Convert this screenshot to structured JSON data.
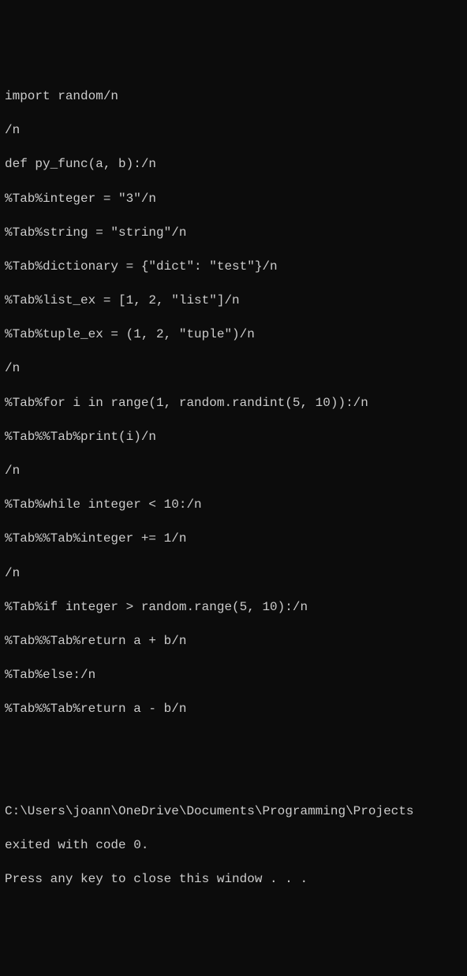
{
  "terminal": {
    "lines": [
      "import random/n",
      "/n",
      "def py_func(a, b):/n",
      "%Tab%integer = \"3\"/n",
      "%Tab%string = \"string\"/n",
      "%Tab%dictionary = {\"dict\": \"test\"}/n",
      "%Tab%list_ex = [1, 2, \"list\"]/n",
      "%Tab%tuple_ex = (1, 2, \"tuple\")/n",
      "/n",
      "%Tab%for i in range(1, random.randint(5, 10)):/n",
      "%Tab%%Tab%print(i)/n",
      "/n",
      "%Tab%while integer < 10:/n",
      "%Tab%%Tab%integer += 1/n",
      "/n",
      "%Tab%if integer > random.range(5, 10):/n",
      "%Tab%%Tab%return a + b/n",
      "%Tab%else:/n",
      "%Tab%%Tab%return a - b/n"
    ],
    "blank_gap": "",
    "exit_path": "C:\\Users\\joann\\OneDrive\\Documents\\Programming\\Projects",
    "exit_message": "exited with code 0.",
    "prompt_message": "Press any key to close this window . . ."
  }
}
